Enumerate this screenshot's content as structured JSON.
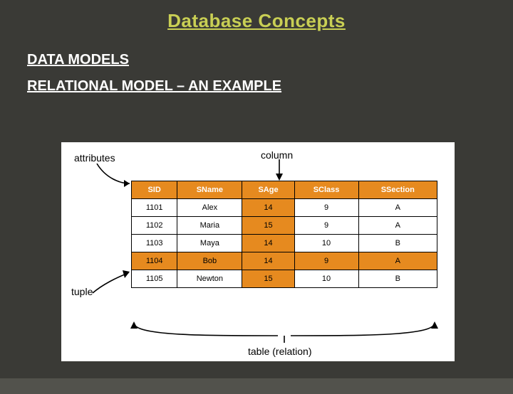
{
  "header": {
    "title": "Database Concepts",
    "section": "DATA MODELS",
    "subheader": "RELATIONAL MODEL – AN EXAMPLE"
  },
  "labels": {
    "attributes": "attributes",
    "column": "column",
    "tuple": "tuple",
    "table_relation": "table (relation)"
  },
  "table": {
    "headers": [
      "SID",
      "SName",
      "SAge",
      "SClass",
      "SSection"
    ],
    "highlight_col_index": 2,
    "highlight_row_index": 3,
    "rows": [
      [
        "1101",
        "Alex",
        "14",
        "9",
        "A"
      ],
      [
        "1102",
        "Maria",
        "15",
        "9",
        "A"
      ],
      [
        "1103",
        "Maya",
        "14",
        "10",
        "B"
      ],
      [
        "1104",
        "Bob",
        "14",
        "9",
        "A"
      ],
      [
        "1105",
        "Newton",
        "15",
        "10",
        "B"
      ]
    ]
  },
  "colors": {
    "slide_bg": "#3a3a36",
    "title": "#c9cf54",
    "accent": "#e68a1f"
  }
}
